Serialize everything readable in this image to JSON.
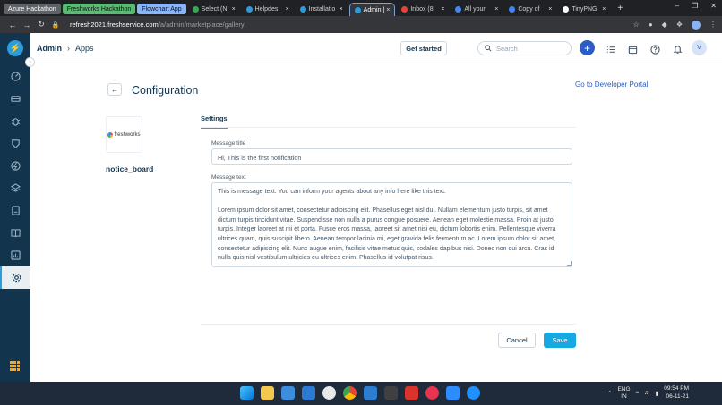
{
  "browser": {
    "tabs": [
      {
        "label": "Azure Hackathon",
        "kind": "group",
        "color": "#5f6368"
      },
      {
        "label": "Freshworks Hackathon",
        "kind": "group",
        "color": "#5bb974"
      },
      {
        "label": "Flowchart App",
        "kind": "group",
        "color": "#8ab4f8"
      },
      {
        "label": "Select (N",
        "kind": "normal",
        "color": "#34a853"
      },
      {
        "label": "Helpdes",
        "kind": "normal",
        "color": "#2c9cdb"
      },
      {
        "label": "Installatio",
        "kind": "normal",
        "color": "#2c9cdb"
      },
      {
        "label": "Admin |",
        "kind": "active",
        "color": "#2c9cdb"
      },
      {
        "label": "Inbox (8",
        "kind": "normal",
        "color": "#ea4335"
      },
      {
        "label": "All your",
        "kind": "normal",
        "color": "#4285f4"
      },
      {
        "label": "Copy of",
        "kind": "normal",
        "color": "#4285f4"
      },
      {
        "label": "TinyPNG",
        "kind": "normal",
        "color": "#ffffff"
      }
    ],
    "url_host": "refresh2021.freshservice.com",
    "url_path": "/a/admin/marketplace/gallery"
  },
  "header": {
    "breadcrumb_root": "Admin",
    "breadcrumb_current": "Apps",
    "get_started": "Get started",
    "search_placeholder": "Search",
    "avatar_initial": "V"
  },
  "page": {
    "title": "Configuration",
    "developer_portal_link": "Go to Developer Portal",
    "app_logo_text": "freshworks",
    "app_name": "notice_board",
    "tab_label": "Settings",
    "message_title_label": "Message title",
    "message_title_value": "Hi, This is the first notification",
    "message_text_label": "Message text",
    "message_text_value": "This is message text. You can inform your agents about any info here like this text.\n\nLorem ipsum dolor sit amet, consectetur adipiscing elit. Phasellus eget nisl dui. Nullam elementum justo turpis, sit amet dictum turpis tincidunt vitae. Suspendisse non nulla a purus congue posuere. Aenean eget molestie massa. Proin at justo turpis. Integer laoreet at mi et porta. Fusce eros massa, laoreet sit amet nisi eu, dictum lobortis enim. Pellentesque viverra ultrices quam, quis suscipit libero. Aenean tempor lacinia mi, eget gravida felis fermentum ac. Lorem ipsum dolor sit amet, consectetur adipiscing elit. Nunc augue enim, facilisis vitae metus quis, sodales dapibus nisi. Donec non dui arcu. Cras id nulla quis nisl vestibulum ultricies eu ultrices enim. Phasellus id volutpat risus.",
    "cancel_label": "Cancel",
    "save_label": "Save"
  },
  "sidebar": {
    "icons": [
      "dashboard-icon",
      "tickets-icon",
      "problems-icon",
      "changes-icon",
      "releases-icon",
      "assets-icon",
      "contracts-icon",
      "solutions-icon",
      "reports-icon",
      "admin-gear-icon"
    ]
  },
  "taskbar": {
    "lang_top": "ENG",
    "lang_bottom": "IN",
    "time": "09:54 PM",
    "date": "06-11-21"
  },
  "colors": {
    "sidebar": "#12344d",
    "primary": "#2c5cc5",
    "save_button": "#16a8e0",
    "taskbar": "#1f2a3a"
  }
}
